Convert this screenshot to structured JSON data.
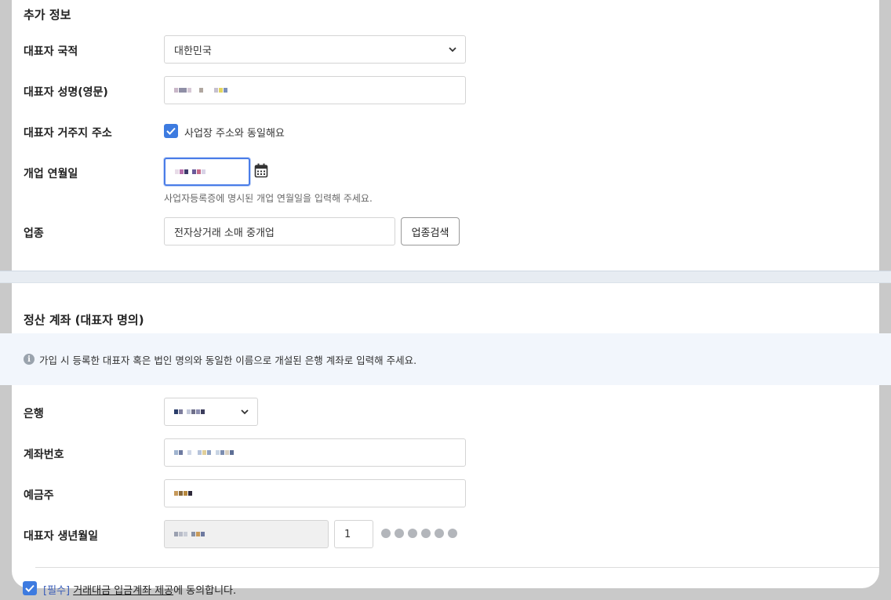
{
  "additional_info": {
    "title": "추가 정보",
    "nationality": {
      "label": "대표자 국적",
      "value": "대한민국"
    },
    "english_name": {
      "label": "대표자 성명(영문)"
    },
    "residence": {
      "label": "대표자 거주지 주소",
      "checkbox_label": "사업장 주소와 동일해요",
      "checked": true
    },
    "open_date": {
      "label": "개업 연월일",
      "helper": "사업자등록증에 명시된 개업 연월일을 입력해 주세요."
    },
    "business_type": {
      "label": "업종",
      "value": "전자상거래 소매 중개업",
      "search_button": "업종검색"
    }
  },
  "settlement": {
    "title": "정산 계좌 (대표자 명의)",
    "notice": "가입 시 등록한 대표자 혹은 법인 명의와 동일한 이름으로 개설된 은행 계좌로 입력해 주세요.",
    "bank": {
      "label": "은행"
    },
    "account_number": {
      "label": "계좌번호"
    },
    "holder": {
      "label": "예금주"
    },
    "birth": {
      "label": "대표자 생년월일",
      "gender_digit": "1",
      "masked_count": 6
    },
    "agreement": {
      "required_tag": "[필수]",
      "link_text": "거래대금 입금계좌 제공",
      "suffix": "에 동의합니다.",
      "checked": true
    }
  },
  "colors": {
    "accent": "#3d7be0",
    "notice_bg": "#f2f6fc",
    "divider_band": "#e7ecf2"
  }
}
